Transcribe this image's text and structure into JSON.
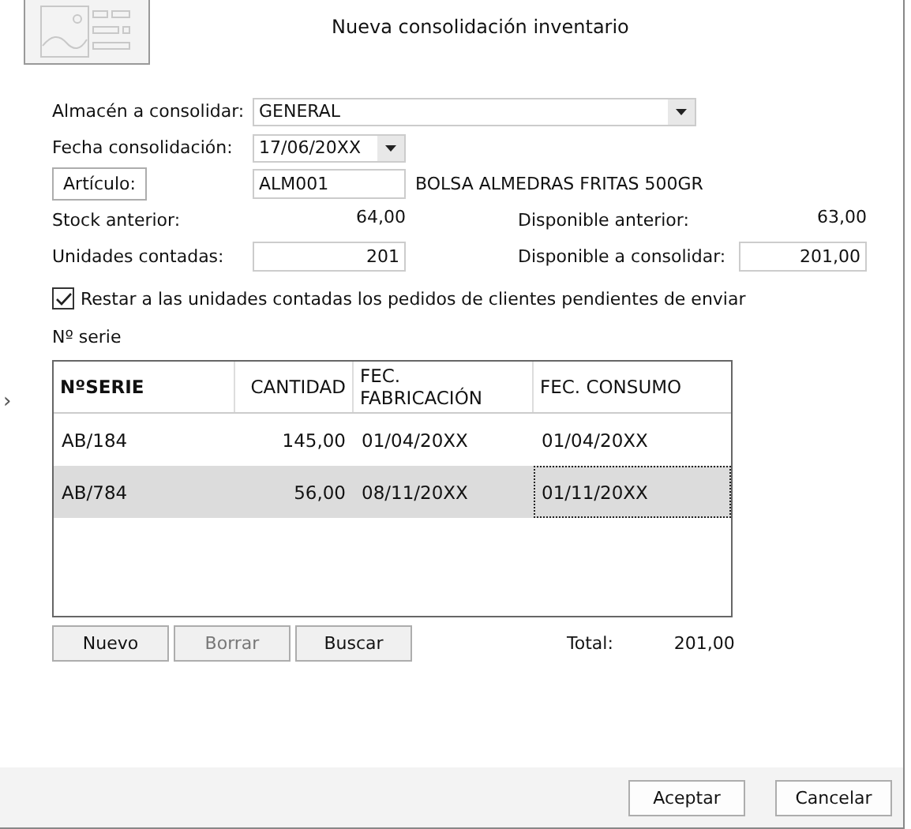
{
  "window": {
    "title": "Nueva consolidación inventario"
  },
  "form": {
    "warehouse": {
      "label": "Almacén a consolidar:",
      "value": "GENERAL"
    },
    "date": {
      "label": "Fecha consolidación:",
      "value": "17/06/20XX"
    },
    "article": {
      "button": "Artículo:",
      "code": "ALM001",
      "description": "BOLSA ALMEDRAS FRITAS 500GR"
    },
    "stock_prev": {
      "label": "Stock anterior:",
      "value": "64,00"
    },
    "avail_prev": {
      "label": "Disponible anterior:",
      "value": "63,00"
    },
    "units_counted": {
      "label": "Unidades contadas:",
      "value": "201"
    },
    "avail_consolidate": {
      "label": "Disponible a consolidar:",
      "value": "201,00"
    },
    "subtract_orders": {
      "label": "Restar a las unidades contadas los pedidos de clientes pendientes de enviar",
      "checked": true
    }
  },
  "serials": {
    "label": "Nº serie",
    "columns": [
      "NºSERIE",
      "CANTIDAD",
      "FEC. FABRICACIÓN",
      "FEC. CONSUMO"
    ],
    "rows": [
      {
        "selected": false,
        "cells": [
          {
            "text": "AB/184",
            "focused": false
          },
          {
            "text": "145,00",
            "focused": false
          },
          {
            "text": "01/04/20XX",
            "focused": false
          },
          {
            "text": "01/04/20XX",
            "focused": false
          }
        ]
      },
      {
        "selected": true,
        "cells": [
          {
            "text": "AB/784",
            "focused": false
          },
          {
            "text": "56,00",
            "focused": false
          },
          {
            "text": "08/11/20XX",
            "focused": false
          },
          {
            "text": "01/11/20XX",
            "focused": true
          }
        ]
      }
    ],
    "buttons": [
      {
        "label": "Nuevo",
        "disabled": false
      },
      {
        "label": "Borrar",
        "disabled": true
      },
      {
        "label": "Buscar",
        "disabled": false
      }
    ],
    "total": {
      "label": "Total:",
      "value": "201,00"
    }
  },
  "side_arrow": "›",
  "footer": {
    "buttons": [
      "Aceptar",
      "Cancelar"
    ]
  }
}
